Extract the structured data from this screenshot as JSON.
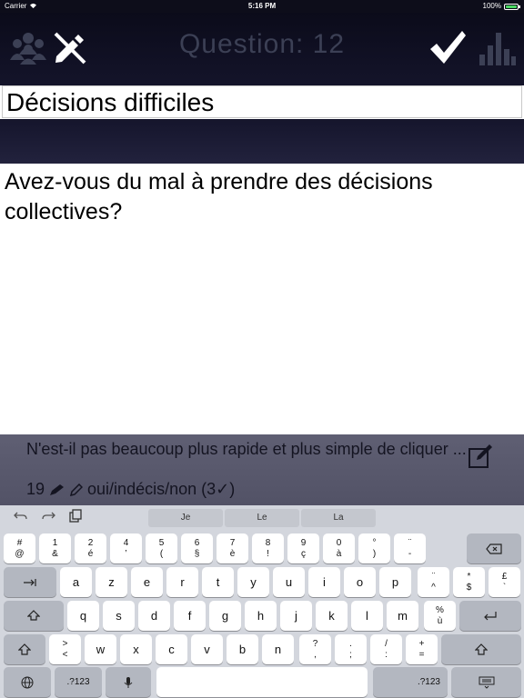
{
  "status_bar": {
    "carrier": "Carrier",
    "time": "5:16 PM",
    "battery": "100%",
    "battery_level": 1.0
  },
  "header": {
    "title": "Question: 12"
  },
  "title_field": {
    "value": "Décisions difficiles"
  },
  "question": {
    "text": "Avez-vous du mal à prendre des décisions collectives?"
  },
  "list_item": {
    "text": "N'est-il pas beaucoup plus rapide et plus simple de cliquer ...",
    "count": "19",
    "options": "oui/indécis/non",
    "answered": "(3✓)"
  },
  "keyboard": {
    "suggestions": [
      "Je",
      "Le",
      "La"
    ],
    "row1": [
      [
        "#",
        "@"
      ],
      [
        "1",
        "&"
      ],
      [
        "2",
        "é"
      ],
      [
        "4",
        "’"
      ],
      [
        "5",
        "("
      ],
      [
        "6",
        "§"
      ],
      [
        "7",
        "è"
      ],
      [
        "8",
        "!"
      ],
      [
        "9",
        "ç"
      ],
      [
        "0",
        "à"
      ],
      [
        "°",
        ")"
      ],
      [
        "¨",
        "-"
      ]
    ],
    "row2": [
      "a",
      "z",
      "e",
      "r",
      "t",
      "y",
      "u",
      "i",
      "o",
      "p"
    ],
    "row2_extra": [
      [
        "¨",
        "^"
      ],
      [
        "*",
        "$"
      ],
      [
        "£",
        "`"
      ]
    ],
    "row3": [
      "q",
      "s",
      "d",
      "f",
      "g",
      "h",
      "j",
      "k",
      "l",
      "m"
    ],
    "row3_extra": [
      [
        "%",
        "ù"
      ]
    ],
    "row4_start": [
      [
        ">",
        "<"
      ]
    ],
    "row4": [
      "w",
      "x",
      "c",
      "v",
      "b",
      "n"
    ],
    "row4_extra": [
      [
        "?",
        ","
      ],
      [
        ".",
        ";"
      ],
      [
        "/",
        ":"
      ],
      [
        "+",
        "="
      ]
    ],
    "numbers_label": ".?123"
  }
}
